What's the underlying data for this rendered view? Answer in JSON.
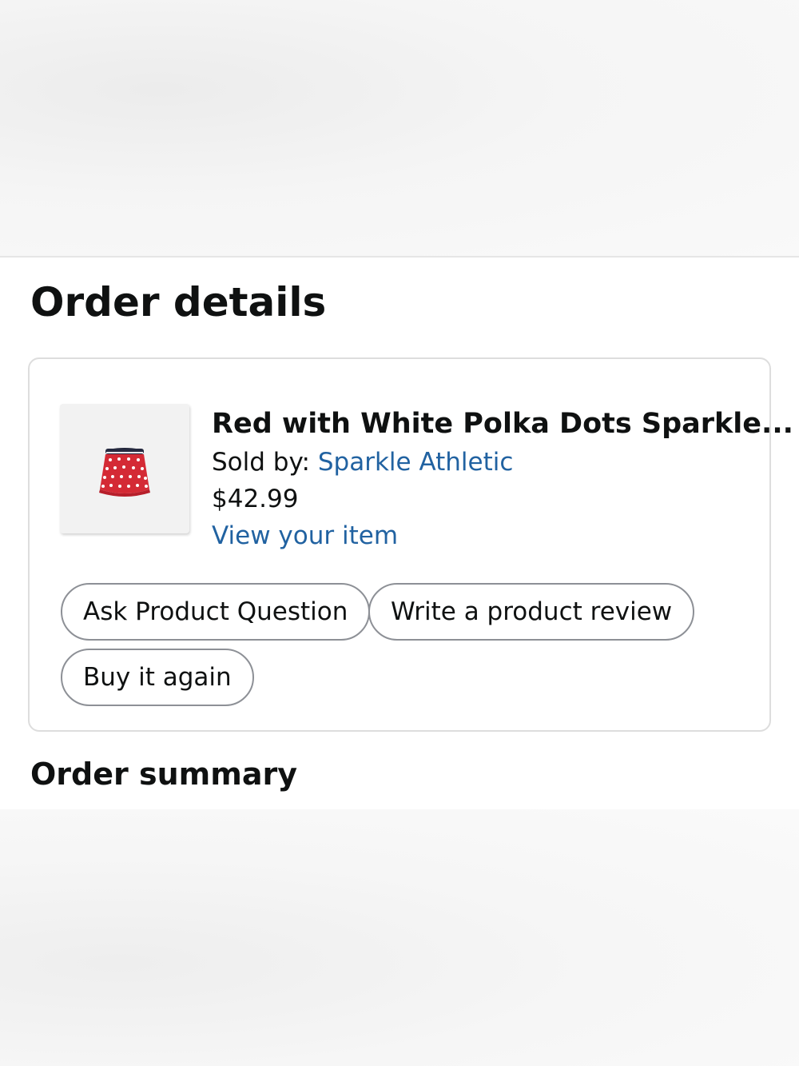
{
  "page": {
    "title": "Order details",
    "summary_title": "Order summary"
  },
  "item": {
    "title": "Red with White Polka Dots Sparkle...",
    "sold_by_label": "Sold by: ",
    "seller": "Sparkle Athletic",
    "price": "$42.99",
    "view_link": "View your item",
    "image_icon": "red-polka-dot-skirt-image"
  },
  "actions": {
    "ask_question": "Ask Product Question",
    "write_review": "Write a product review",
    "buy_again": "Buy it again"
  },
  "colors": {
    "link": "#2162a1",
    "text": "#0f1111",
    "button_border": "#8d9096",
    "card_border": "#dddddd",
    "product_red": "#d42a35"
  }
}
